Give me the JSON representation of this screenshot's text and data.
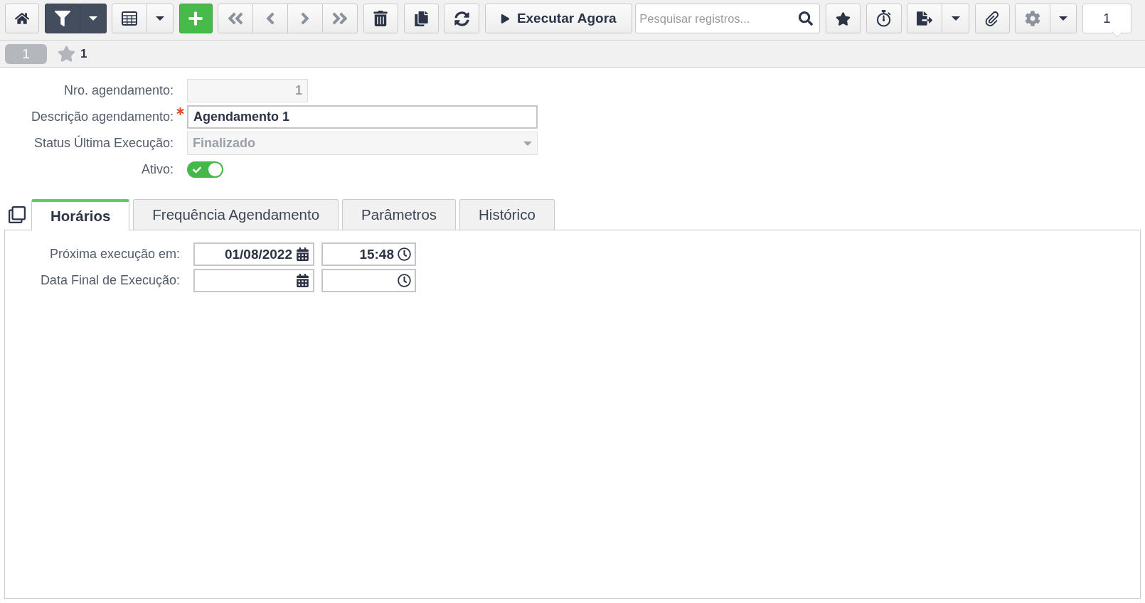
{
  "toolbar": {
    "filter_active": true,
    "navigation_disabled": true,
    "run_button": "Executar Agora",
    "search": {
      "placeholder": "Pesquisar registros..."
    },
    "page_indicator": "1"
  },
  "record_bar": {
    "record_tab": "1",
    "star_label": "1"
  },
  "form": {
    "fields": [
      {
        "label": "Nro. agendamento:",
        "kind": "number",
        "value": "1",
        "disabled": true,
        "required": false
      },
      {
        "label": "Descrição agendamento:",
        "kind": "text",
        "value": "Agendamento 1",
        "disabled": false,
        "required": true
      },
      {
        "label": "Status Última Execução:",
        "kind": "select",
        "value": "Finalizado",
        "disabled": true,
        "required": false
      },
      {
        "label": "Ativo:",
        "kind": "toggle",
        "on": true,
        "disabled": false,
        "required": false
      }
    ]
  },
  "tabs": [
    {
      "label": "Horários",
      "selected": true
    },
    {
      "label": "Frequência Agendamento",
      "selected": false
    },
    {
      "label": "Parâmetros",
      "selected": false
    },
    {
      "label": "Histórico",
      "selected": false
    }
  ],
  "tab_panel": {
    "rows": [
      {
        "label": "Próxima execução em:",
        "date": "01/08/2022",
        "time": "15:48"
      },
      {
        "label": "Data Final de Execução:"
      }
    ]
  }
}
